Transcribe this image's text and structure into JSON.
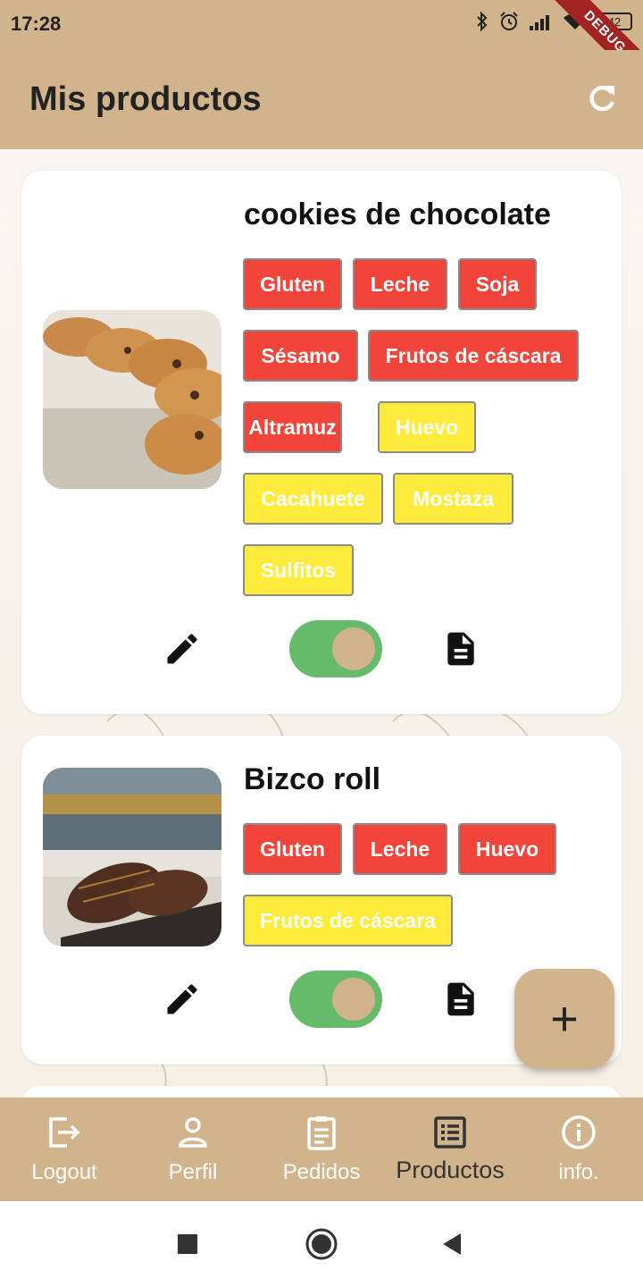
{
  "status_bar": {
    "time": "17:28",
    "battery": "42"
  },
  "debug_banner": "DEBUG",
  "app_bar": {
    "title": "Mis productos",
    "refresh_icon": "refresh-icon"
  },
  "products": [
    {
      "name": "cookies de chocolate",
      "image": "cookies-photo",
      "allergens_contains": [
        "Gluten",
        "Leche",
        "Soja",
        "Sésamo",
        "Frutos de cáscara",
        "Altramuz"
      ],
      "allergens_traces": [
        "Huevo",
        "Cacahuete",
        "Mostaza",
        "Sulfitos"
      ],
      "active": true
    },
    {
      "name": "Bizco roll",
      "image": "bizco-roll-photo",
      "allergens_contains": [
        "Gluten",
        "Leche",
        "Huevo"
      ],
      "allergens_traces": [
        "Frutos de cáscara"
      ],
      "active": true
    }
  ],
  "tag_colors": {
    "contains": "#f1453b",
    "traces": "#ffeb3b"
  },
  "fab": {
    "icon": "plus-icon",
    "label": "+"
  },
  "bottom_nav": [
    {
      "label": "Logout",
      "icon": "logout-icon",
      "active": false
    },
    {
      "label": "Perfil",
      "icon": "person-icon",
      "active": false
    },
    {
      "label": "Pedidos",
      "icon": "clipboard-icon",
      "active": false
    },
    {
      "label": "Productos",
      "icon": "list-alt-icon",
      "active": true
    },
    {
      "label": "info.",
      "icon": "info-icon",
      "active": false
    }
  ],
  "colors": {
    "brand": "#d2b48c",
    "toggle_on": "#66bb6a"
  }
}
